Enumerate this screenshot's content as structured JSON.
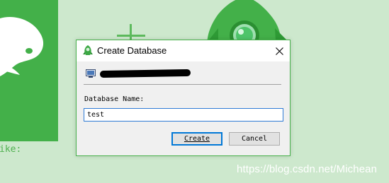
{
  "dialog": {
    "title": "Create Database",
    "field_label": "Database Name:",
    "field_value": "test",
    "create_label": "Create",
    "cancel_label": "Cancel"
  },
  "background": {
    "partial_text": "ike:",
    "watermark": "https://blog.csdn.net/Michean"
  },
  "icons": {
    "app": "app-logo-icon",
    "close": "close-icon",
    "database": "database-icon"
  },
  "colors": {
    "brand_green": "#43b049",
    "focus_blue": "#0078d7"
  }
}
